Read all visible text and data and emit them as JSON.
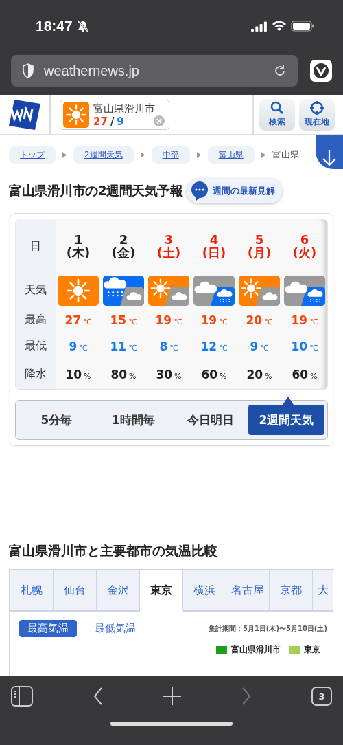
{
  "status_bar": {
    "time": "18:47"
  },
  "browser": {
    "url": "weathernews.jp",
    "tab_count": "3"
  },
  "header": {
    "location": "富山県滑川市",
    "weather": [
      {
        "kind": "sun"
      }
    ],
    "high": "27",
    "separator": "/",
    "low": "9",
    "buttons": [
      "検索",
      "現在地"
    ]
  },
  "breadcrumbs": [
    {
      "label": "トップ",
      "kind": "link"
    },
    {
      "label": "2週間天気",
      "kind": "link"
    },
    {
      "label": "中部",
      "kind": "link"
    },
    {
      "label": "富山県",
      "kind": "link"
    },
    {
      "label": "富山県",
      "kind": "current"
    }
  ],
  "title": "富山県滑川市の2週間天気予報",
  "opinion_button": "週間の最新見解",
  "forecast": {
    "row_labels": [
      "日",
      "天気",
      "最高",
      "最低",
      "降水"
    ],
    "days": [
      {
        "date": "1",
        "weekday": "(木)",
        "holiday": false,
        "weather": [
          {
            "kind": "sun"
          }
        ],
        "high": "27",
        "low": "9",
        "precip": "10"
      },
      {
        "date": "2",
        "weekday": "(金)",
        "holiday": false,
        "weather": [
          {
            "kind": "rain"
          },
          {
            "kind": "cloud"
          }
        ],
        "high": "15",
        "low": "11",
        "precip": "80"
      },
      {
        "date": "3",
        "weekday": "(土)",
        "holiday": true,
        "weather": [
          {
            "kind": "sun"
          },
          {
            "kind": "cloud"
          }
        ],
        "high": "19",
        "low": "8",
        "precip": "30"
      },
      {
        "date": "4",
        "weekday": "(日)",
        "holiday": true,
        "weather": [
          {
            "kind": "cloud"
          },
          {
            "kind": "rain"
          }
        ],
        "high": "19",
        "low": "12",
        "precip": "60"
      },
      {
        "date": "5",
        "weekday": "(月)",
        "holiday": true,
        "weather": [
          {
            "kind": "sun"
          },
          {
            "kind": "cloud"
          }
        ],
        "high": "20",
        "low": "9",
        "precip": "20"
      },
      {
        "date": "6",
        "weekday": "(火)",
        "holiday": true,
        "weather": [
          {
            "kind": "cloud"
          },
          {
            "kind": "rain"
          }
        ],
        "high": "19",
        "low": "10",
        "precip": "60"
      }
    ],
    "temp_unit": "℃",
    "precip_unit": "%"
  },
  "view_tabs": [
    {
      "label": "5分毎",
      "selected": false
    },
    {
      "label": "1時間毎",
      "selected": false
    },
    {
      "label": "今日明日",
      "selected": false
    },
    {
      "label": "2週間天気",
      "selected": true
    }
  ],
  "comparison": {
    "title": "富山県滑川市と主要都市の気温比較",
    "city_tabs": [
      {
        "label": "札幌",
        "selected": false
      },
      {
        "label": "仙台",
        "selected": false
      },
      {
        "label": "金沢",
        "selected": false
      },
      {
        "label": "東京",
        "selected": true
      },
      {
        "label": "横浜",
        "selected": false
      },
      {
        "label": "名古屋",
        "selected": false
      },
      {
        "label": "京都",
        "selected": false
      },
      {
        "label": "大",
        "selected": false
      }
    ],
    "filters": [
      {
        "label": "最高気温",
        "selected": true
      },
      {
        "label": "最低気温",
        "selected": false
      }
    ],
    "period": "集計期間：5月1日(木)〜5月10日(土)",
    "legend": [
      {
        "label": "富山県滑川市",
        "color": "#1ea01e"
      },
      {
        "label": "東京",
        "color": "#a8d050"
      }
    ]
  }
}
